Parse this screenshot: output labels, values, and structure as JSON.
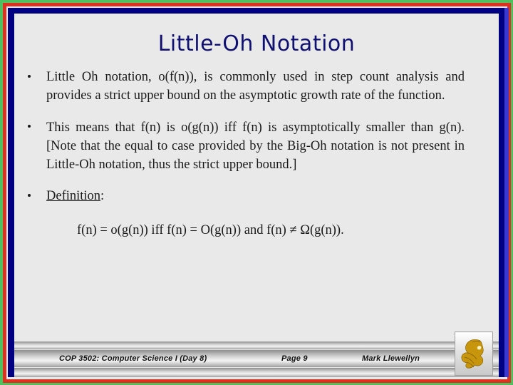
{
  "slide": {
    "title": "Little-Oh Notation",
    "bullets": [
      {
        "text": "Little Oh notation, o(f(n)),  is commonly used in step count analysis and provides a strict upper bound on the asymptotic growth rate of the function."
      },
      {
        "text": "This means that f(n) is o(g(n)) iff f(n) is asymptotically smaller than g(n).  [Note that the equal to case provided by the Big-Oh notation is not present in Little-Oh notation, thus the strict upper bound.]"
      },
      {
        "label": "Definition",
        "suffix": ":"
      }
    ],
    "formula": "f(n) = o(g(n)) iff f(n) = O(g(n)) and f(n) ≠ Ω(g(n))."
  },
  "footer": {
    "course": "COP 3502: Computer Science I  (Day 8)",
    "page": "Page 9",
    "author": "Mark Llewellyn",
    "logo": "ucf-pegasus-logo"
  },
  "colors": {
    "border_green": "#4fbf5f",
    "border_red": "#e03020",
    "border_navy": "#000082",
    "border_blue": "#3a3ad0",
    "canvas": "#e9e9e9",
    "title": "#101073",
    "body_text": "#1a1a1a",
    "logo_gold": "#c8960c"
  }
}
